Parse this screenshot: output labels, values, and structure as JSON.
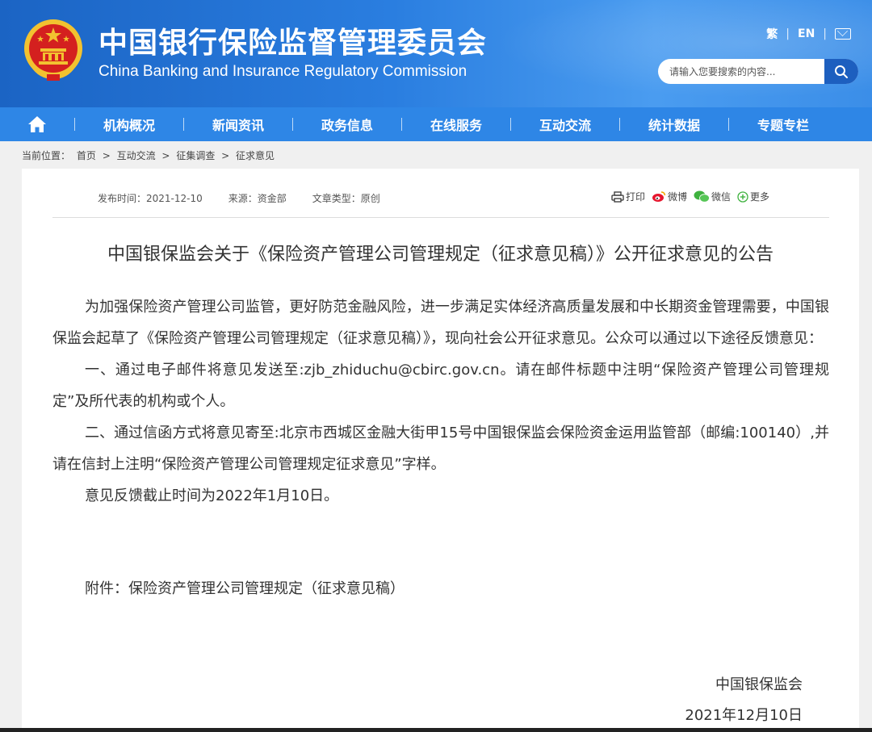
{
  "header": {
    "title_cn": "中国银行保险监督管理委员会",
    "title_en": "China Banking and Insurance Regulatory Commission",
    "lang_traditional": "繁",
    "lang_en": "EN",
    "search_placeholder": "请输入您要搜索的内容...",
    "colors": {
      "header_blue": "#2a7ee0",
      "nav_blue": "#2e86e6",
      "search_button": "#1d5fbf",
      "emblem_red": "#d4201f",
      "emblem_gold": "#f2c230"
    }
  },
  "nav": {
    "items": [
      "机构概况",
      "新闻资讯",
      "政务信息",
      "在线服务",
      "互动交流",
      "统计数据",
      "专题专栏"
    ]
  },
  "breadcrumb": {
    "prefix": "当前位置：",
    "items": [
      "首页",
      "互动交流",
      "征集调查",
      "征求意见"
    ],
    "separator": ">"
  },
  "article": {
    "publish_time": "发布时间：2021-12-10",
    "source": "来源：资金部",
    "type": "文章类型：原创",
    "share": {
      "print": "打印",
      "weibo": "微博",
      "wechat": "微信",
      "more": "更多"
    },
    "title": "中国银保监会关于《保险资产管理公司管理规定（征求意见稿）》公开征求意见的公告",
    "paragraphs": [
      "为加强保险资产管理公司监管，更好防范金融风险，进一步满足实体经济高质量发展和中长期资金管理需要，中国银保监会起草了《保险资产管理公司管理规定（征求意见稿）》，现向社会公开征求意见。公众可以通过以下途径反馈意见：",
      "一、通过电子邮件将意见发送至:zjb_zhiduchu@cbirc.gov.cn。请在邮件标题中注明“保险资产管理公司管理规定”及所代表的机构或个人。",
      "二、通过信函方式将意见寄至:北京市西城区金融大街甲15号中国银保监会保险资金运用监管部（邮编:100140）,并请在信封上注明“保险资产管理公司管理规定征求意见”字样。",
      "意见反馈截止时间为2022年1月10日。"
    ],
    "attachment": "附件：保险资产管理公司管理规定（征求意见稿）",
    "signature_org": "中国银保监会",
    "signature_date": "2021年12月10日"
  }
}
